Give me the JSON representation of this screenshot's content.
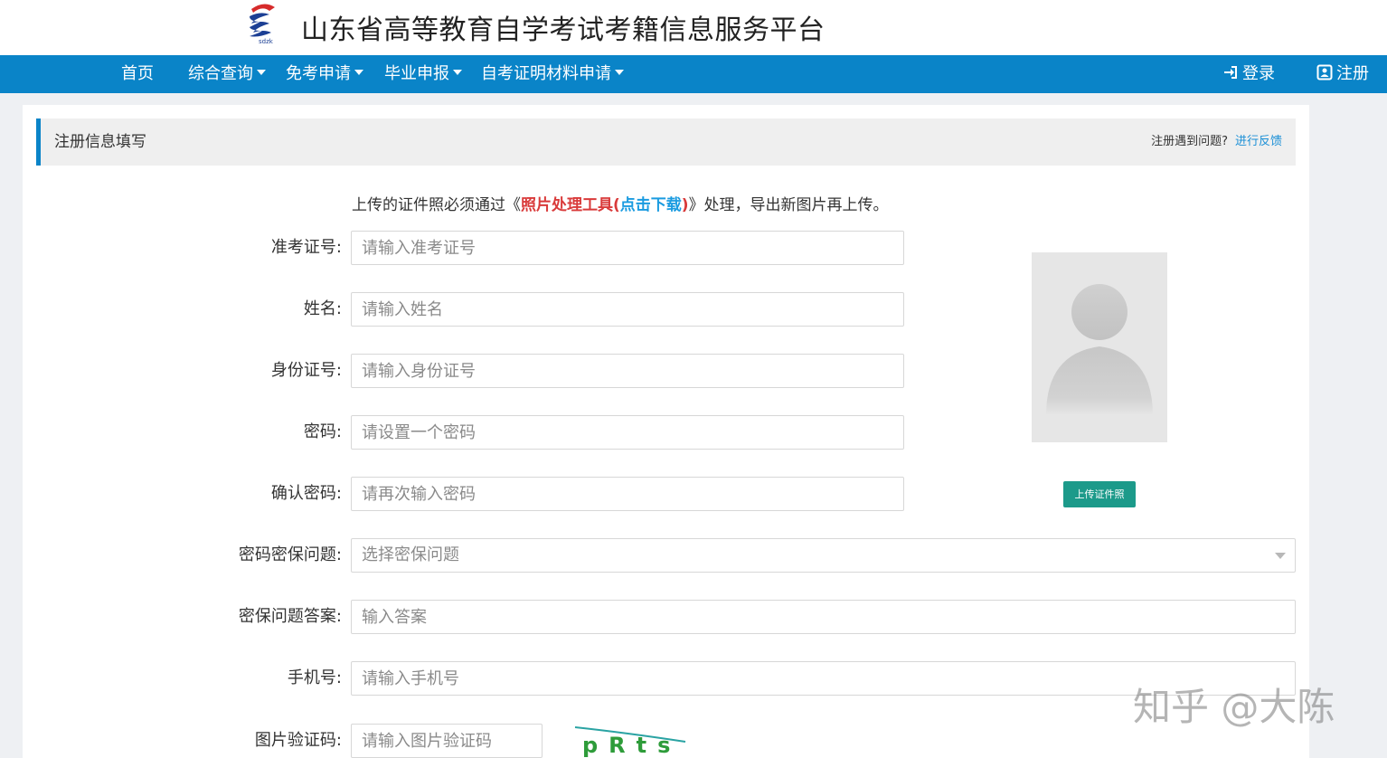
{
  "header": {
    "site_title": "山东省高等教育自学考试考籍信息服务平台",
    "logo_text": "sdzk",
    "logo_colors": {
      "red": "#d62b2b",
      "blue": "#1c3f94"
    }
  },
  "nav": {
    "items": [
      {
        "label": "首页",
        "has_dropdown": false
      },
      {
        "label": "综合查询",
        "has_dropdown": true
      },
      {
        "label": "免考申请",
        "has_dropdown": true
      },
      {
        "label": "毕业申报",
        "has_dropdown": true
      },
      {
        "label": "自考证明材料申请",
        "has_dropdown": true
      }
    ],
    "login_label": "登录",
    "register_label": "注册",
    "bg_color": "#0a84c8"
  },
  "section": {
    "title": "注册信息填写",
    "help_text": "注册遇到问题?",
    "feedback_link": "进行反馈"
  },
  "notice": {
    "prefix": "上传的证件照必须通过《",
    "tool_name": "照片处理工具(",
    "download_link": "点击下载",
    "tool_close": ")",
    "suffix": "》处理，导出新图片再上传。"
  },
  "form": {
    "exam_id": {
      "label": "准考证号:",
      "placeholder": "请输入准考证号"
    },
    "name": {
      "label": "姓名:",
      "placeholder": "请输入姓名"
    },
    "id_card": {
      "label": "身份证号:",
      "placeholder": "请输入身份证号"
    },
    "password": {
      "label": "密码:",
      "placeholder": "请设置一个密码"
    },
    "confirm_password": {
      "label": "确认密码:",
      "placeholder": "请再次输入密码"
    },
    "security_question": {
      "label": "密码密保问题:",
      "placeholder": "选择密保问题"
    },
    "security_answer": {
      "label": "密保问题答案:",
      "placeholder": "输入答案"
    },
    "phone": {
      "label": "手机号:",
      "placeholder": "请输入手机号"
    },
    "captcha": {
      "label": "图片验证码:",
      "placeholder": "请输入图片验证码",
      "image_text": "pRts"
    }
  },
  "photo": {
    "upload_button": "上传证件照",
    "button_color": "#1c9a8a"
  },
  "watermark": "知乎 @大陈"
}
